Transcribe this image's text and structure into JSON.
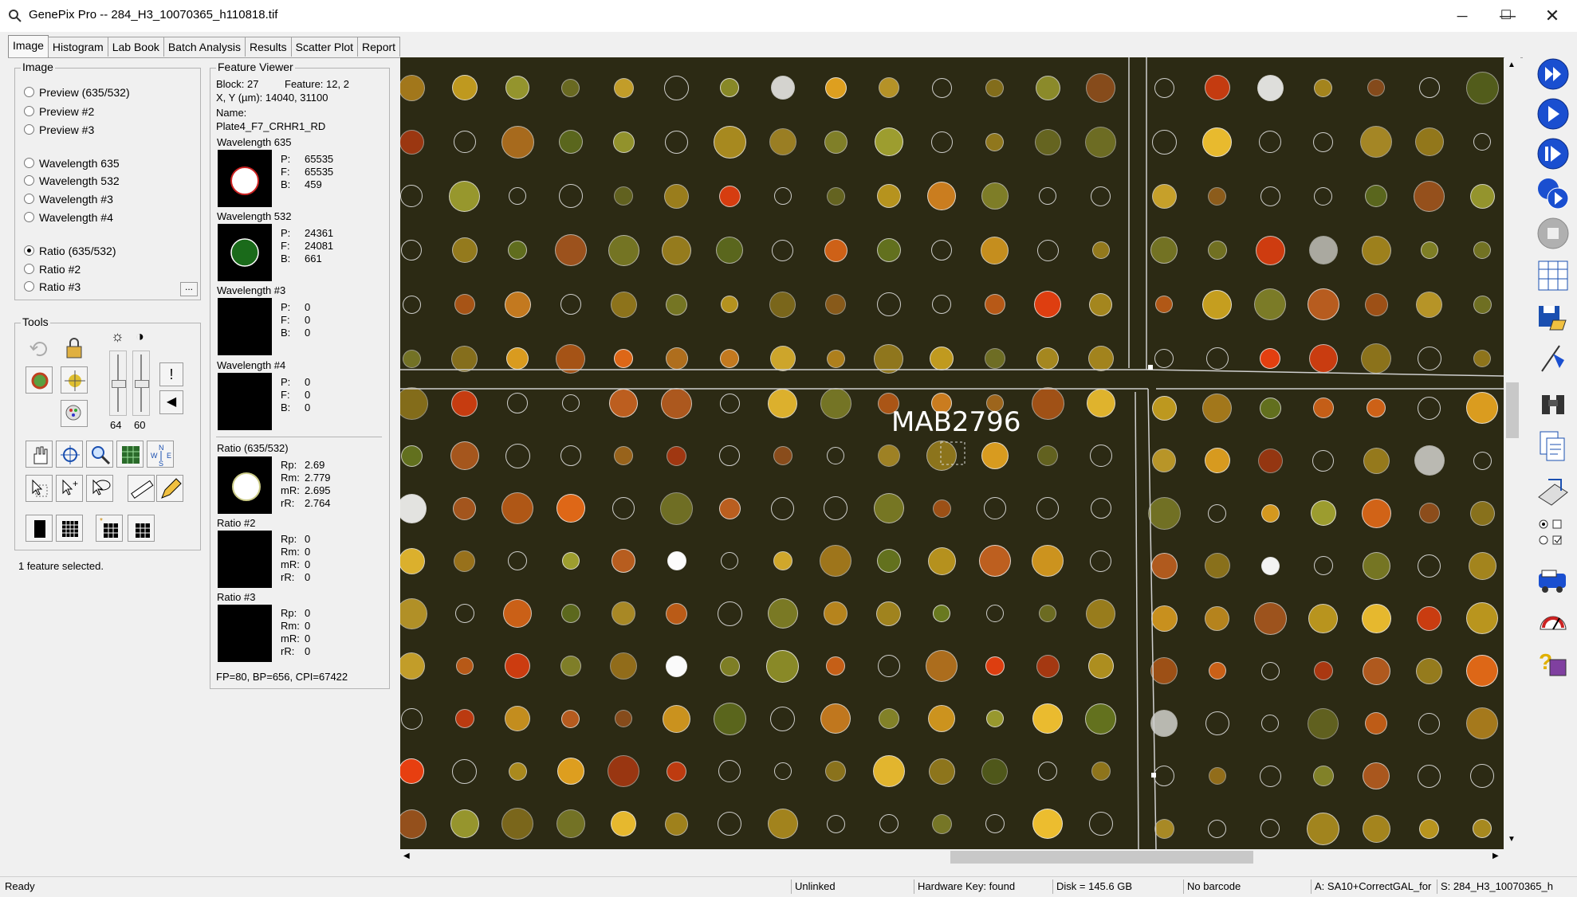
{
  "window": {
    "title": "GenePix Pro -- 284_H3_10070365_h110818.tif"
  },
  "tabs": [
    "Image",
    "Histogram",
    "Lab Book",
    "Batch Analysis",
    "Results",
    "Scatter Plot",
    "Report"
  ],
  "image_group": {
    "legend": "Image",
    "options": [
      "Preview (635/532)",
      "Preview #2",
      "Preview #3",
      "Wavelength 635",
      "Wavelength 532",
      "Wavelength #3",
      "Wavelength #4",
      "Ratio (635/532)",
      "Ratio #2",
      "Ratio #3"
    ],
    "selected": "Ratio (635/532)",
    "more": "..."
  },
  "tools": {
    "legend": "Tools",
    "slider1": "64",
    "slider2": "60"
  },
  "selection_text": "1 feature selected.",
  "feature_viewer": {
    "legend": "Feature Viewer",
    "block": "Block: 27",
    "feature": "Feature:  12, 2",
    "xy": "X, Y (µm): 14040, 31100",
    "name_label": "Name:",
    "name": "Plate4_F7_CRHR1_RD",
    "w635": {
      "label": "Wavelength 635",
      "P": "65535",
      "F": "65535",
      "B": "459"
    },
    "w532": {
      "label": "Wavelength 532",
      "P": "24361",
      "F": "24081",
      "B": "661"
    },
    "w3": {
      "label": "Wavelength #3",
      "P": "0",
      "F": "0",
      "B": "0"
    },
    "w4": {
      "label": "Wavelength #4",
      "P": "0",
      "F": "0",
      "B": "0"
    },
    "r1": {
      "label": "Ratio (635/532)",
      "Rp": "2.69",
      "Rm": "2.779",
      "mR": "2.695",
      "rR": "2.764"
    },
    "r2": {
      "label": "Ratio #2",
      "Rp": "0",
      "Rm": "0",
      "mR": "0",
      "rR": "0"
    },
    "r3": {
      "label": "Ratio #3",
      "Rp": "0",
      "Rm": "0",
      "mR": "0",
      "rR": "0"
    },
    "keys": {
      "P": "P:",
      "F": "F:",
      "B": "B:",
      "Rp": "Rp:",
      "Rm": "Rm:",
      "mR": "mR:",
      "rR": "rR:"
    },
    "footer": "FP=80, BP=656, CPI=67422"
  },
  "annotation": "MAB2796",
  "status": {
    "ready": "Ready",
    "link": "Unlinked",
    "key": "Hardware Key: found",
    "disk": "Disk = 145.6 GB",
    "barcode": "No barcode",
    "gal": "A: SA10+CorrectGAL_for",
    "scan": "S: 284_H3_10070365_h"
  },
  "colors": {
    "image_background": "#2c2a14",
    "accent_blue": "#1a5fd0"
  }
}
